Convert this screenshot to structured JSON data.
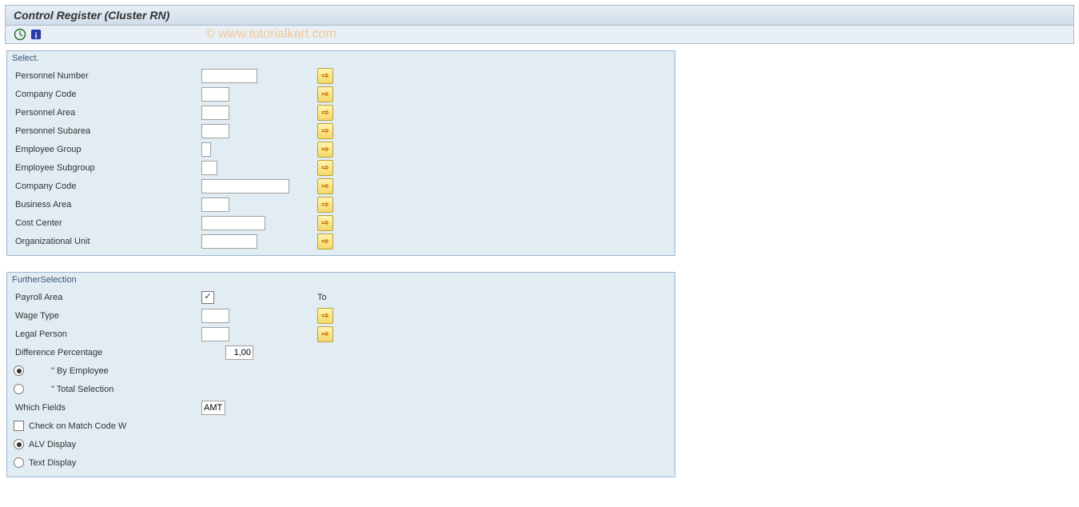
{
  "title": "Control Register (Cluster RN)",
  "watermark": "© www.tutorialkart.com",
  "groups": {
    "select": {
      "title": "Select.",
      "rows": {
        "personnel_number": "Personnel Number",
        "company_code": "Company Code",
        "personnel_area": "Personnel Area",
        "personnel_subarea": "Personnel Subarea",
        "employee_group": "Employee Group",
        "employee_subgroup": "Employee Subgroup",
        "company_code2": "Company Code",
        "business_area": "Business Area",
        "cost_center": "Cost Center",
        "org_unit": "Organizational Unit"
      }
    },
    "further": {
      "title": "FurtherSelection",
      "payroll_area": "Payroll Area",
      "to_label": "To",
      "wage_type": "Wage Type",
      "legal_person": "Legal Person",
      "diff_pct_label": "Difference Percentage",
      "diff_pct_value": "1,00",
      "by_employee": "\"     By Employee",
      "total_selection": "\"     Total Selection",
      "which_fields": "Which Fields",
      "which_fields_value": "AMT",
      "check_match": "Check on Match Code W",
      "alv_display": "ALV Display",
      "text_display": "Text Display",
      "checkmark": "✓"
    }
  }
}
